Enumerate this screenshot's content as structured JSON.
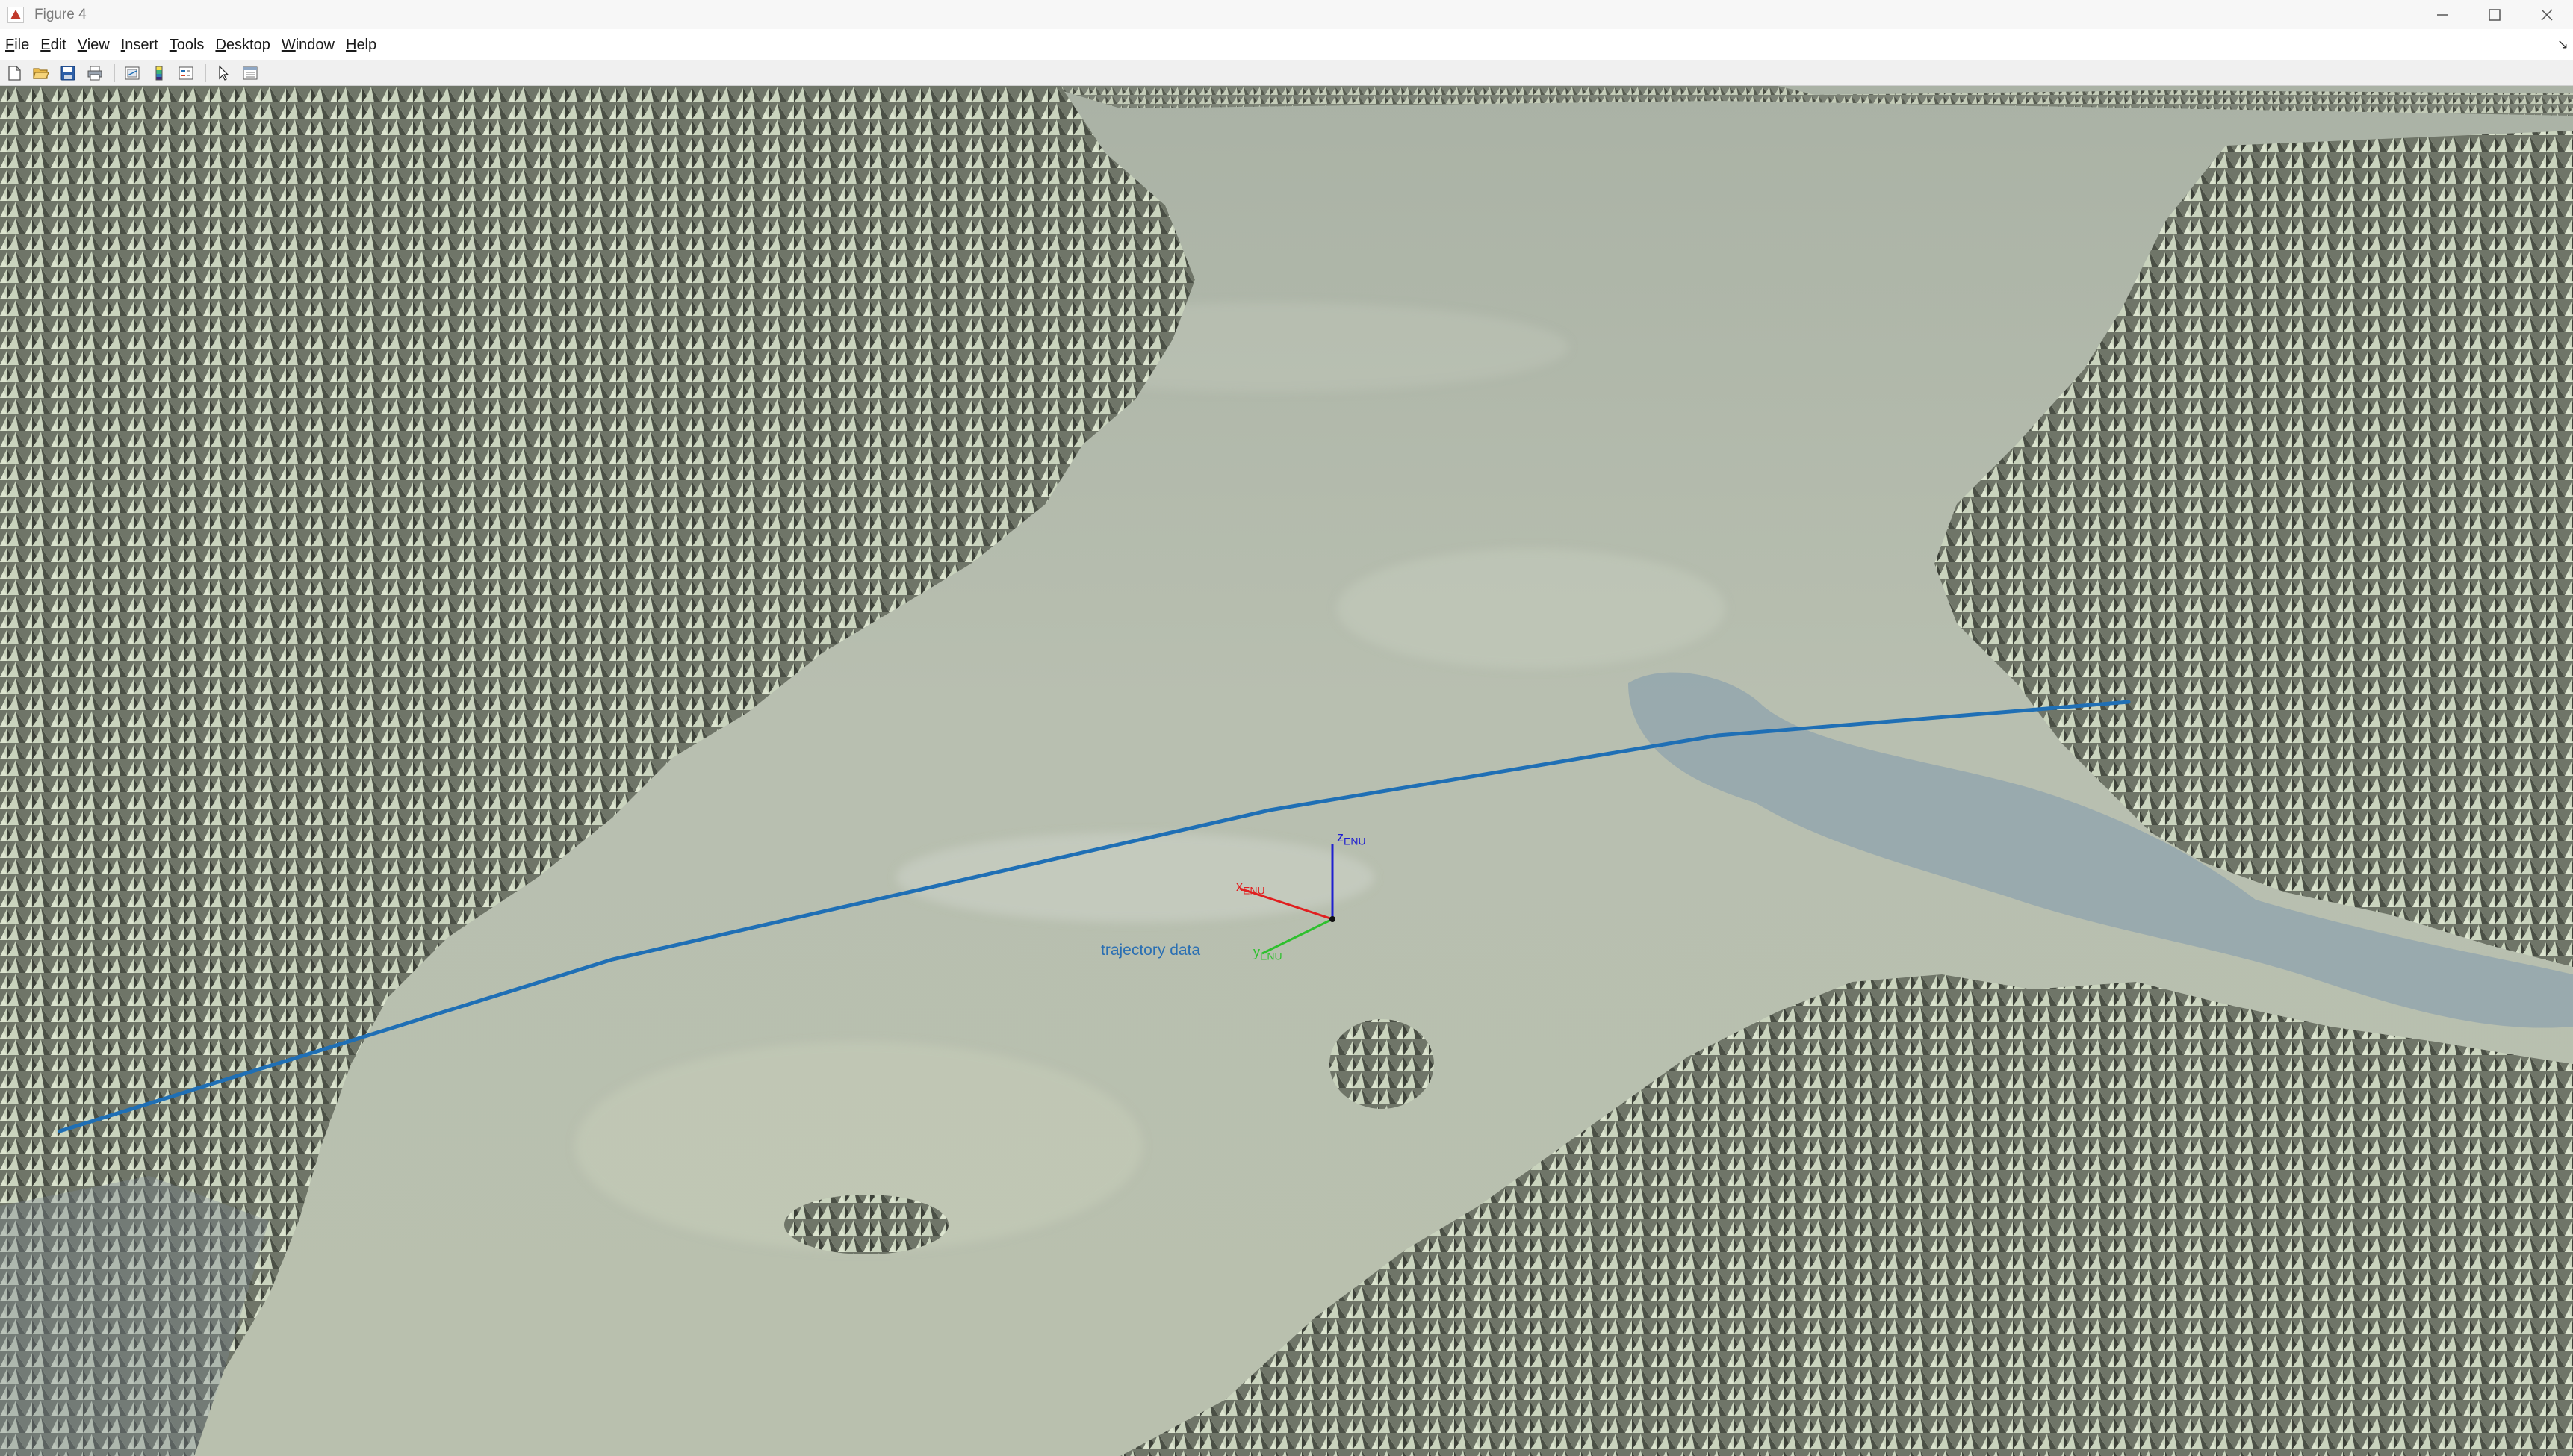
{
  "window": {
    "title": "Figure 4",
    "minimize_icon": "minimize-icon",
    "maximize_icon": "maximize-icon",
    "close_icon": "close-icon"
  },
  "menu": {
    "items": [
      "File",
      "Edit",
      "View",
      "Insert",
      "Tools",
      "Desktop",
      "Window",
      "Help"
    ],
    "dock_glyph": "↘"
  },
  "toolbar": {
    "buttons": [
      {
        "name": "new-figure-button",
        "icon": "new-file-icon"
      },
      {
        "name": "open-file-button",
        "icon": "open-folder-icon"
      },
      {
        "name": "save-figure-button",
        "icon": "save-disk-icon"
      },
      {
        "name": "print-figure-button",
        "icon": "printer-icon"
      },
      {
        "name": "link-plot-button",
        "icon": "link-plot-icon"
      },
      {
        "name": "insert-colorbar-button",
        "icon": "colorbar-icon"
      },
      {
        "name": "insert-legend-button",
        "icon": "legend-icon"
      },
      {
        "name": "edit-plot-button",
        "icon": "pointer-arrow-icon"
      },
      {
        "name": "property-inspector-button",
        "icon": "property-inspector-icon"
      }
    ]
  },
  "plot": {
    "trajectory_label": "trajectory data",
    "trajectory_color": "#1f6fb5",
    "axes": {
      "x": {
        "letter": "x",
        "sub": "ENU",
        "color": "#e02020"
      },
      "y": {
        "letter": "y",
        "sub": "ENU",
        "color": "#2ec02e"
      },
      "z": {
        "letter": "z",
        "sub": "ENU",
        "color": "#2020d0"
      }
    }
  }
}
